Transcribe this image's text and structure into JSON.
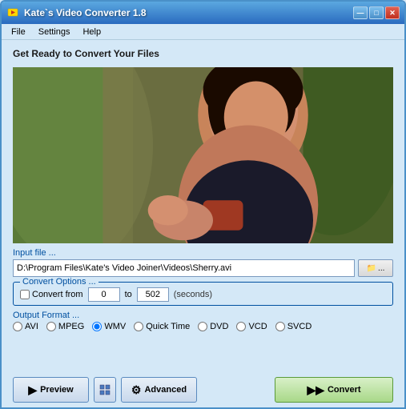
{
  "window": {
    "title": "Kate`s Video Converter 1.8",
    "icon": "🎬"
  },
  "titlebar": {
    "minimize": "—",
    "maximize": "□",
    "close": "✕"
  },
  "menu": {
    "items": [
      "File",
      "Settings",
      "Help"
    ]
  },
  "main": {
    "heading": "Get Ready to Convert Your Files"
  },
  "input_section": {
    "label": "Input file ...",
    "value": "D:\\Program Files\\Kate's Video Joiner\\Videos\\Sherry.avi",
    "browse_text": "..."
  },
  "convert_options": {
    "label": "Convert Options ...",
    "checkbox_label": "Convert from",
    "from_value": "0",
    "to_value": "502",
    "seconds_label": "(seconds)"
  },
  "output_format": {
    "label": "Output Format ...",
    "options": [
      "AVI",
      "MPEG",
      "WMV",
      "Quick Time",
      "DVD",
      "VCD",
      "SVCD"
    ],
    "selected": "WMV"
  },
  "buttons": {
    "preview": "Preview",
    "advanced": "Advanced",
    "convert": "Convert"
  },
  "colors": {
    "accent": "#0050a0",
    "btn_green": "#5a9a3a"
  }
}
